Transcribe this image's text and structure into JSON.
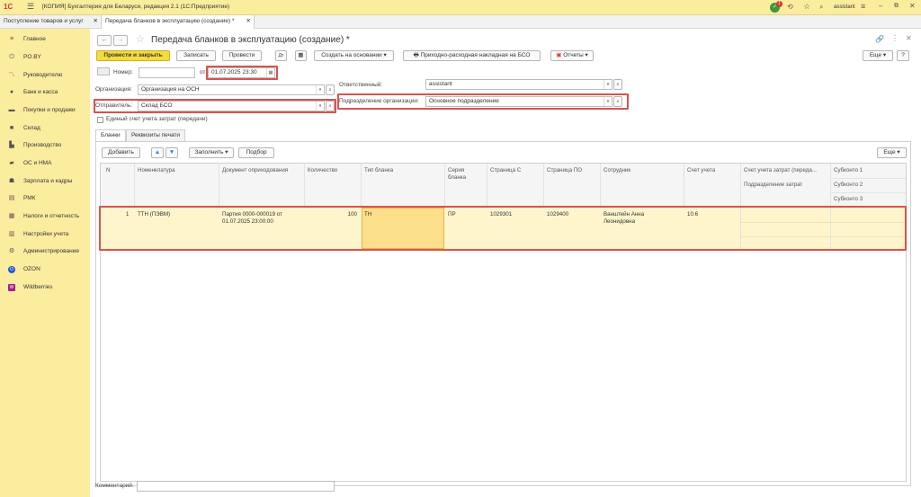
{
  "window": {
    "title": "[КОПИЯ] Бухгалтерия для Беларуси, редакция 2.1  (1С:Предприятие)",
    "user": "assistant",
    "notifications": "1"
  },
  "open_tabs": [
    {
      "label": "Поступление товаров и услуг"
    },
    {
      "label": "Передача бланков в эксплуатацию (создание) *"
    }
  ],
  "sidebar": {
    "items": [
      {
        "label": "Главное",
        "icon": "menu-icon"
      },
      {
        "label": "PO.BY",
        "icon": "power-icon"
      },
      {
        "label": "Руководителю",
        "icon": "chart-icon"
      },
      {
        "label": "Банк и касса",
        "icon": "bank-icon"
      },
      {
        "label": "Покупки и продажи",
        "icon": "cart-icon"
      },
      {
        "label": "Склад",
        "icon": "warehouse-icon"
      },
      {
        "label": "Производство",
        "icon": "factory-icon"
      },
      {
        "label": "ОС и НМА",
        "icon": "car-icon"
      },
      {
        "label": "Зарплата и кадры",
        "icon": "people-icon"
      },
      {
        "label": "РМК",
        "icon": "cashier-icon"
      },
      {
        "label": "Налоги и отчетность",
        "icon": "taxes-icon"
      },
      {
        "label": "Настройки учета",
        "icon": "ledger-icon"
      },
      {
        "label": "Администрирование",
        "icon": "gear-icon"
      },
      {
        "label": "OZON",
        "icon": "ozon-icon"
      },
      {
        "label": "Wildberries",
        "icon": "wildberries-icon"
      }
    ]
  },
  "document": {
    "title": "Передача бланков в эксплуатацию (создание) *",
    "toolbar": {
      "post_close": "Провести и закрыть",
      "save": "Записать",
      "post": "Провести",
      "create_based": "Создать на основании",
      "invoice_bso": "Приходно-расходная накладная на БСО",
      "reports": "Отчеты",
      "more": "Еще"
    },
    "fields": {
      "number_label": "Номер:",
      "number_value": "",
      "date_from_label": "от:",
      "date_value": "01.07.2025 23:30",
      "org_label": "Организация:",
      "org_value": "Организация на ОСН",
      "sender_label": "Отправитель:",
      "sender_value": "Склад БСО",
      "responsible_label": "Ответственный:",
      "responsible_value": "assistant",
      "department_label": "Подразделение организации:",
      "department_value": "Основное подразделение",
      "single_account_label": "Единый счет учета затрат (передачи)"
    },
    "tabs": [
      {
        "label": "Бланки"
      },
      {
        "label": "Реквизиты печати"
      }
    ],
    "table_toolbar": {
      "add": "Добавить",
      "fill": "Заполнить",
      "pick": "Подбор",
      "more": "Еще"
    },
    "table": {
      "headers": {
        "n": "N",
        "nomenclature": "Номенклатура",
        "receipt_doc": "Документ оприходования",
        "quantity": "Количество",
        "form_type": "Тип бланка",
        "series": "Серия бланка",
        "page_from": "Страница С",
        "page_to": "Страница ПО",
        "employee": "Сотрудник",
        "account": "Счет учета",
        "cost_account": "Счет учета затрат (переда...",
        "cost_department": "Подразделение затрат",
        "subconto1": "Субконто 1",
        "subconto2": "Субконто 2",
        "subconto3": "Субконто 3"
      },
      "rows": [
        {
          "n": "1",
          "nomenclature": "ТТН (ПЭВМ)",
          "receipt_doc": "Партия 0000-000019 от 01.07.2025 23:00:00",
          "quantity": "100",
          "form_type": "ТН",
          "series": "ПР",
          "page_from": "1029301",
          "page_to": "1029400",
          "employee": "Ванштейн Анна Леонидовна",
          "account": "10.6",
          "cost_account": "",
          "cost_department": "",
          "subconto1": "",
          "subconto2": "",
          "subconto3": ""
        }
      ]
    },
    "comment_label": "Комментарий:",
    "comment_value": ""
  },
  "colors": {
    "accent_yellow": "#f5dc3c",
    "sidebar_bg": "#fbed9e",
    "highlight_red": "#d9534f",
    "selected_row": "#fff5cc",
    "selected_cell": "#fbdf8a"
  }
}
